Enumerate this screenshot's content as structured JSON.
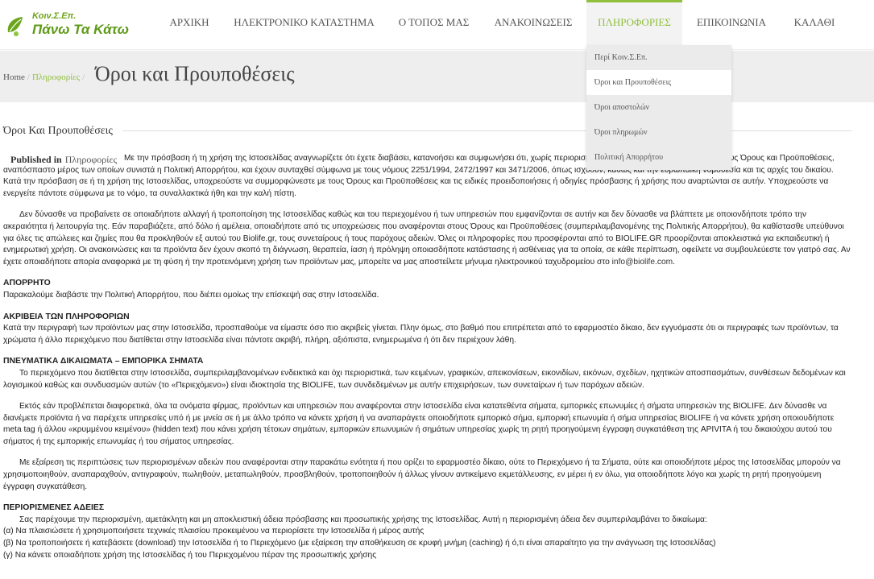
{
  "logo": {
    "top_text": "Κοιν.Σ.Επ.",
    "main_text": "Πάνω Τα Κάτω"
  },
  "nav": {
    "items": [
      "ΑΡΧΙΚΗ",
      "ΗΛΕΚΤΡΟΝΙΚΟ ΚΑΤΑΣΤΗΜΑ",
      "Ο ΤΟΠΟΣ ΜΑΣ",
      "ΑΝΑΚΟΙΝΩΣΕΙΣ",
      "ΠΛΗΡΟΦΟΡΙΕΣ",
      "ΕΠΙΚΟΙΝΩΝΙΑ",
      "ΚΑΛΑΘΙ"
    ],
    "active": "ΠΛΗΡΟΦΟΡΙΕΣ"
  },
  "dropdown": {
    "items": [
      "Περί Κοιν.Σ.Επ.",
      "Όροι και Προυποθέσεις",
      "Όροι αποστολών",
      "Όροι πληρωμών",
      "Πολιτική Απορρήτου"
    ],
    "selected": "Όροι και Προυποθέσεις"
  },
  "breadcrumb": {
    "home": "Home",
    "sep": "/",
    "parent": "Πληροφορίες",
    "sep2": "/"
  },
  "page_title": "Όροι και Προυποθέσεις",
  "article": {
    "title": "Όροι Και Προυποθέσεις",
    "published_label": "Published in",
    "published_category": "Πληροφορίες",
    "p1": "Με την πρόσβαση ή τη χρήση της Ιστοσελίδας αναγνωρίζετε ότι έχετε διαβάσει, κατανοήσει και συμφωνήσει ότι, χωρίς περιορισμούς, προσωπικώς, δεσμεύεστε από τους Όρους και Προϋποθέσεις, αναπόσπαστο μέρος των οποίων συνιστά η Πολιτική Απορρήτου, και έχουν συνταχθεί σύμφωνα με τους νόμους 2251/1994, 2472/1997 και 3471/2006, όπως ισχύουν, καθώς και την ευρωπαϊκή νομοθεσία και τις αρχές του δικαίου. Κατά την πρόσβαση σε ή τη χρήση της Ιστοσελίδας, υποχρεούστε να συμμορφώνεστε με τους Όρους και Προϋποθέσεις και τις ειδικές προειδοποιήσεις ή οδηγίες πρόσβασης ή χρήσης που αναρτώνται σε αυτήν. Υποχρεούστε να ενεργείτε πάντοτε σύμφωνα με το νόμο, τα συναλλακτικά ήθη και την καλή πίστη.",
    "p2": "Δεν δύνασθε να προβαίνετε σε οποιαδήποτε αλλαγή ή τροποποίηση της Ιστοσελίδας καθώς και του περιεχομένου ή των υπηρεσιών που εμφανίζονται σε αυτήν και δεν δύνασθε να βλάπτετε με οποιονδήποτε τρόπο την ακεραιότητα ή λειτουργία της. Εάν παραβιάζετε, από δόλο ή αμέλεια, οποιαδήποτε από τις υποχρεώσεις που αναφέρονται στους Όρους και Προϋποθέσεις (συμπεριλαμβανομένης της Πολιτικής Απορρήτου), θα καθίστασθε υπεύθυνοι για όλες τις απώλειες και ζημίες που θα προκληθούν εξ αυτού του Biolife.gr, τους συνεταίρους ή τους παρόχους αδειών. Όλες οι πληροφορίες που προσφέρονται από το BIOLIFE.GR προορίζονται αποκλειστικά για εκπαιδευτική ή ενημερωτική χρήση. Οι ανακοινώσεις και τα προϊόντα δεν έχουν σκοπό τη διάγνωση, θεραπεία, ίαση ή πρόληψη οποιασδήποτε κατάστασης ή ασθένειας για τα οποία, σε κάθε περίπτωση, οφείλετε να συμβουλεύεστε τον γιατρό σας. Αν έχετε οποιαδήποτε απορία αναφορικά με τη φύση ή την προτεινόμενη χρήση των προϊόντων μας, μπορείτε να μας αποστείλετε μήνυμα ηλεκτρονικού ταχυδρομείου στο",
    "email": "info@biolife.com",
    "p2_end": ".",
    "h_privacy": "ΑΠΟΡΡΗΤΟ",
    "p_privacy": "Παρακαλούμε διαβάστε την Πολιτική Απορρήτου, που διέπει ομοίως την επίσκεψή σας στην Ιστοσελίδα.",
    "h_accuracy": "ΑΚΡΙΒΕΙΑ ΤΩΝ ΠΛΗΡΟΦΟΡΙΩΝ",
    "p_accuracy": "Κατά την περιγραφή των προϊόντων μας στην Ιστοσελίδα, προσπαθούμε να είμαστε όσο πιο ακριβείς γίνεται. Πλην όμως, στο βαθμό που επιτρέπεται από το εφαρμοστέο δίκαιο, δεν εγγυόμαστε ότι οι περιγραφές των προϊόντων, τα χρώματα ή άλλο περιεχόμενο που διατίθεται στην Ιστοσελίδα είναι πάντοτε ακριβή, πλήρη, αξιόπιστα, ενημερωμένα ή ότι δεν περιέχουν λάθη.",
    "h_ip": "ΠΝΕΥΜΑΤΙΚΑ ΔΙΚΑΙΩΜΑΤΑ – ΕΜΠΟΡΙΚΑ ΣΗΜΑΤΑ",
    "p_ip1": "Το περιεχόμενο που διατίθεται στην Ιστοσελίδα, συμπεριλαμβανομένων ενδεικτικά και όχι περιοριστικά, των κειμένων, γραφικών, απεικονίσεων, εικονιδίων, εικόνων, σχεδίων, ηχητικών αποσπασμάτων, συνθέσεων δεδομένων και λογισμικού καθώς και συνδυασμών αυτών (το «Περιεχόμενο») είναι ιδιοκτησία της BIOLIFE, των συνδεδεμένων με αυτήν επιχειρήσεων, των συνεταίρων ή των παρόχων αδειών.",
    "p_ip2": "Εκτός εάν προβλέπεται διαφορετικά, όλα τα ονόματα φίρμας, προϊόντων και υπηρεσιών που αναφέρονται στην Ιστοσελίδα είναι κατατεθέντα σήματα, εμπορικές επωνυμίες ή σήματα υπηρεσιών της BIOLIFE. Δεν δύνασθε να διανέμετε προϊόντα ή να παρέχετε υπηρεσίες υπό ή με μνεία σε ή με άλλο τρόπο να κάνετε χρήση ή να αναπαράγετε οποιοδήποτε εμπορικό σήμα, εμπορική επωνυμία ή σήμα υπηρεσίας BIOLIFE ή να κάνετε χρήση οποιουδήποτε meta tag ή άλλου «κρυμμένου κειμένου» (hidden text) που κάνει χρήση τέτοιων σημάτων, εμπορικών επωνυμιών ή σημάτων υπηρεσίας χωρίς τη ρητή προηγούμενη έγγραφη συγκατάθεση της APIVITA ή του δικαιούχου αυτού του σήματος ή της εμπορικής επωνυμίας ή του σήματος υπηρεσίας.",
    "p_ip3": "Με εξαίρεση τις περιπτώσεις των περιορισμένων αδειών που αναφέρονται στην παρακάτω ενότητα ή που ορίζει το εφαρμοστέο δίκαιο, ούτε το Περιεχόμενο ή τα Σήματα, ούτε και οποιοδήποτε μέρος της Ιστοσελίδας μπορούν να χρησιμοποιηθούν, αναπαραχθούν, αντιγραφούν, πωληθούν, μεταπωληθούν, προσβληθούν, τροποποιηθούν ή άλλως γίνουν αντικείμενο εκμετάλλευσης, εν μέρει ή εν όλω, για οποιοδήποτε λόγο και χωρίς τη ρητή προηγούμενη έγγραφη συγκατάθεση.",
    "h_licenses": "ΠΕΡΙΟΡΙΣΜΕΝΕΣ ΑΔΕΙΕΣ",
    "p_lic": "Σας παρέχουμε την περιορισμένη, αμετάκλητη και μη αποκλειστική άδεια πρόσβασης και προσωπικής χρήσης της Ιστοσελίδας. Αυτή η περιορισμένη άδεια δεν συμπεριλαμβάνει το δικαίωμα:",
    "li_a": "(α) Να πλαισιώσετε ή χρησιμοποιήσετε τεχνικές πλαισίου προκειμένου να περιορίσετε την Ιστοσελίδα ή μέρος αυτής",
    "li_b": "(β) Να τροποποιήσετε ή κατεβάσετε (download) την Ιστοσελίδα ή το Περιεχόμενο (με εξαίρεση την αποθήκευση σε κρυφή μνήμη (caching) ή ό,τι είναι απαραίτητο για την ανάγνωση της Ιστοσελίδας)",
    "li_c": "(γ) Να κάνετε οποιαδήποτε χρήση της Ιστοσελίδας ή του Περιεχομένου πέραν της προσωπικής χρήσης"
  }
}
